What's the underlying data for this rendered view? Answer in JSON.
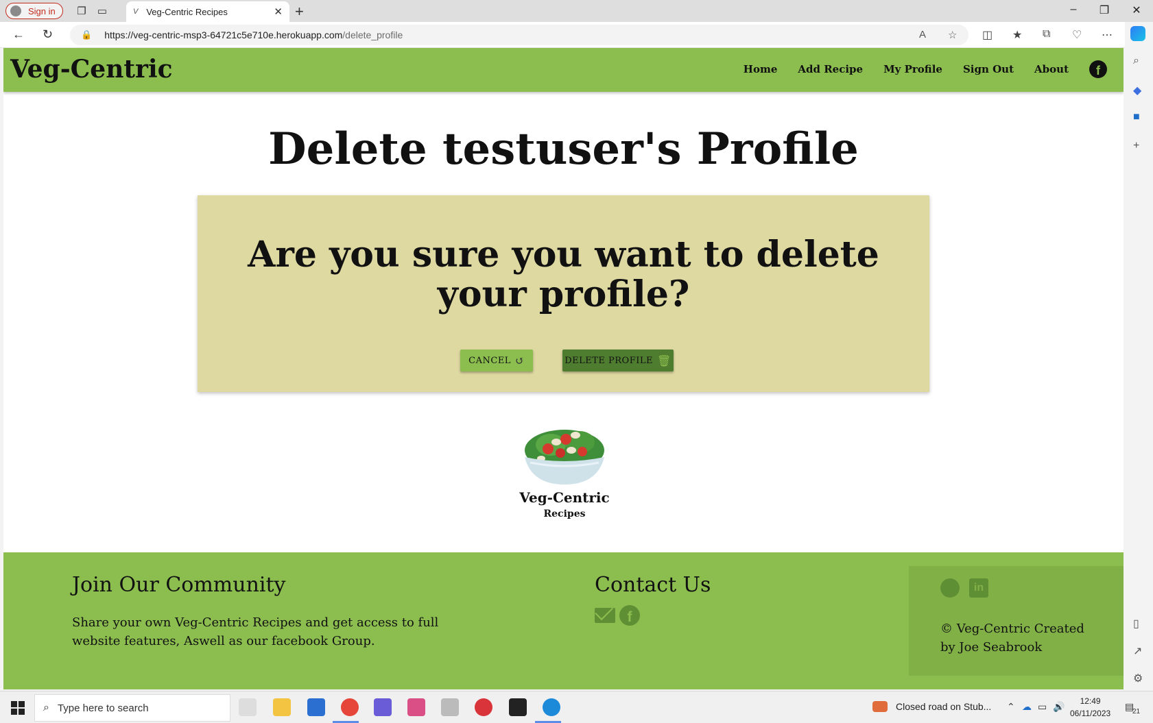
{
  "browser": {
    "profile_label": "Sign in",
    "tab_title": "Veg-Centric Recipes",
    "url_host": "https://veg-centric-msp3-64721c5e710e.herokuapp.com",
    "url_path": "/delete_profile"
  },
  "site": {
    "brand": "Veg-Centric",
    "nav": [
      "Home",
      "Add Recipe",
      "My Profile",
      "Sign Out",
      "About"
    ]
  },
  "main": {
    "title": "Delete testuser's Profile",
    "question": "Are you sure you want to delete your profile?",
    "cancel_label": "CANCEL",
    "delete_label": "DELETE PROFILE",
    "logo_name": "Veg-Centric",
    "logo_sub": "Recipes"
  },
  "footer": {
    "community_heading": "Join Our Community",
    "community_text": "Share your own Veg-Centric Recipes and get access to full website features, Aswell as our facebook Group.",
    "contact_heading": "Contact Us",
    "copyright": "© Veg-Centric Created by Joe Seabrook"
  },
  "taskbar": {
    "search_placeholder": "Type here to search",
    "notification": "Closed road on Stub...",
    "time": "12:49",
    "date": "06/11/2023",
    "badge": "21"
  },
  "colors": {
    "brand_green": "#8bbd4f",
    "dark_green": "#4f7d2f",
    "card_bg": "#ded8a1"
  },
  "icons": {
    "cancel": "undo-icon",
    "delete": "trash-icon",
    "social": [
      "github-icon",
      "linkedin-icon"
    ],
    "contact": [
      "envelope-icon",
      "facebook-icon"
    ]
  }
}
